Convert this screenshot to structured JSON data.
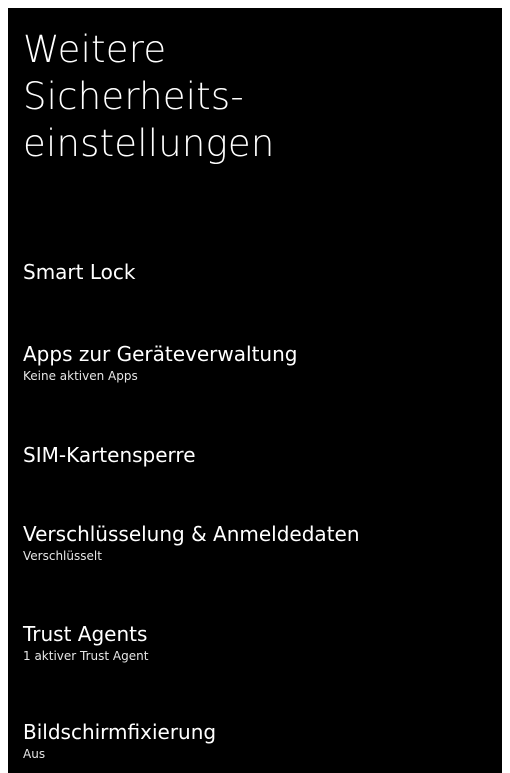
{
  "header": {
    "title_lines": [
      "Weitere",
      "Sicherheits-",
      "einstellungen"
    ]
  },
  "settings": [
    {
      "title": "Smart Lock",
      "summary": ""
    },
    {
      "title": "Apps zur Geräteverwaltung",
      "summary": "Keine aktiven Apps"
    },
    {
      "title": "SIM-Kartensperre",
      "summary": ""
    },
    {
      "title": "Verschlüsselung & Anmeldedaten",
      "summary": "Verschlüsselt"
    },
    {
      "title": "Trust Agents",
      "summary": "1 aktiver Trust Agent"
    },
    {
      "title": "Bildschirmfixierung",
      "summary": "Aus"
    }
  ],
  "colors": {
    "background": "#000000",
    "text": "#ffffff",
    "summary_text": "#e6e6e6"
  }
}
